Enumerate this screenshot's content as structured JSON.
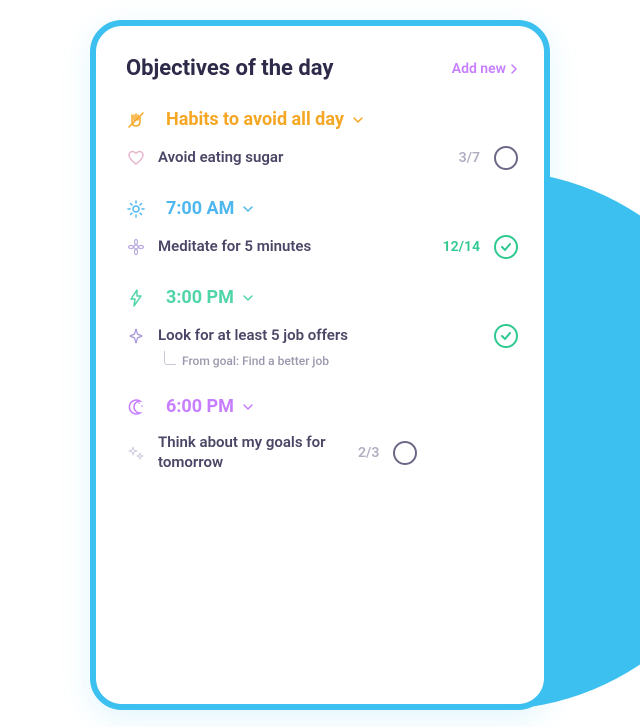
{
  "header": {
    "title": "Objectives of the day",
    "add_new": "Add new"
  },
  "sections": {
    "avoid": {
      "title": "Habits to avoid all day",
      "items": {
        "sugar": {
          "text": "Avoid eating sugar",
          "count": "3/7"
        }
      }
    },
    "morning": {
      "title": "7:00 AM",
      "items": {
        "meditate": {
          "text": "Meditate for 5 minutes",
          "count": "12/14"
        }
      }
    },
    "afternoon": {
      "title": "3:00 PM",
      "items": {
        "jobs": {
          "text": "Look for at least 5 job offers",
          "goal": "From goal: Find a better job"
        }
      }
    },
    "evening": {
      "title": "6:00 PM",
      "items": {
        "goals": {
          "text": "Think about my goals for tomorrow",
          "count": "2/3"
        }
      }
    }
  }
}
